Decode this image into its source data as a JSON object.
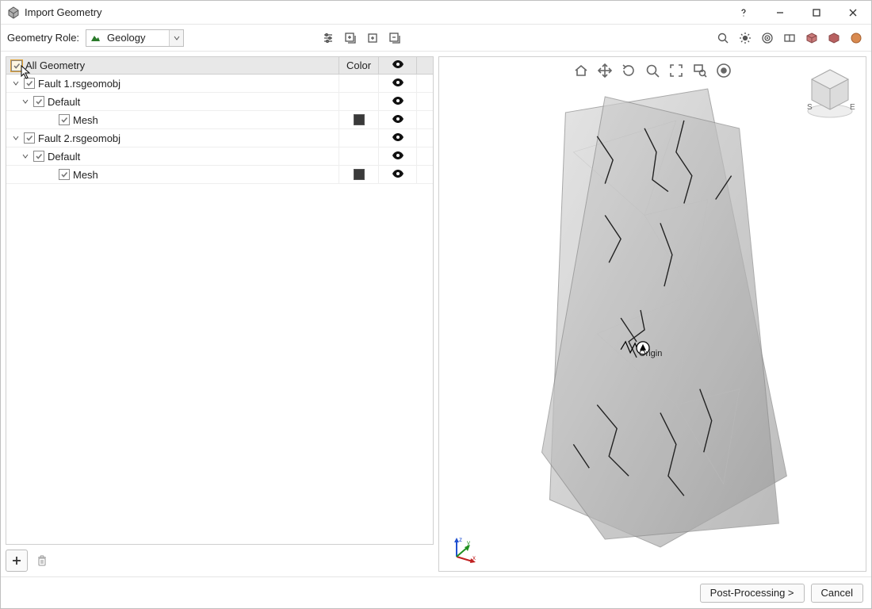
{
  "titlebar": {
    "title": "Import Geometry"
  },
  "toolbar": {
    "role_label": "Geometry Role:",
    "role_value": "Geology"
  },
  "tree": {
    "header": {
      "name": "",
      "color": "Color",
      "vis": ""
    },
    "root": "All Geometry",
    "items": [
      {
        "label": "Fault 1.rsgeomobj"
      },
      {
        "label": "Default"
      },
      {
        "label": "Mesh",
        "color": "#3a3a3a"
      },
      {
        "label": "Fault 2.rsgeomobj"
      },
      {
        "label": "Default"
      },
      {
        "label": "Mesh",
        "color": "#3a3a3a"
      }
    ]
  },
  "viewport": {
    "origin_label": "Origin",
    "compass": {
      "s": "S",
      "e": "E"
    }
  },
  "footer": {
    "post": "Post-Processing >",
    "cancel": "Cancel"
  }
}
